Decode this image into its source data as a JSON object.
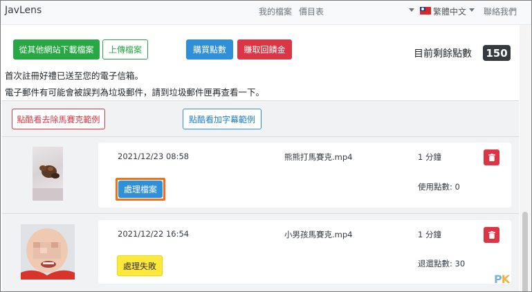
{
  "navbar": {
    "brand": "JavLens",
    "my_files": "我的檔案",
    "price_list": "價目表",
    "language": "繁體中文",
    "contact": "聯絡我們"
  },
  "toolbar": {
    "download_other": "從其他網站下載檔案",
    "upload": "上傳檔案",
    "buy_points": "購買點數",
    "earn_rebate": "賺取回饋金",
    "points_label": "目前剩餘點數",
    "points_value": "150"
  },
  "notices": [
    "首次註冊好禮已送至您的電子信箱。",
    "電子郵件有可能會被誤判為垃圾郵件，請到垃圾郵件匣再查看一下。"
  ],
  "examples": {
    "remove_mosaic": "點酷看去除馬賽克範例",
    "add_subtitle": "點酷看加字幕範例"
  },
  "files": [
    {
      "datetime": "2021/12/23 08:58",
      "filename": "熊熊打馬賽克.mp4",
      "duration": "1 分鐘",
      "action_label": "處理檔案",
      "points_text": "使用點數: 0"
    },
    {
      "datetime": "2021/12/22 16:54",
      "filename": "小男孩馬賽克.mp4",
      "duration": "1 分鐘",
      "action_label": "處理失敗",
      "points_text": "退還點數: 30"
    }
  ],
  "watermark": {
    "p": "P",
    "k": "K"
  },
  "colors": {
    "accent_green": "#28a745",
    "accent_blue": "#2f8fd8",
    "accent_red": "#dc3545",
    "highlight_orange": "#ff6a13",
    "failed_yellow": "#ffe83c"
  }
}
